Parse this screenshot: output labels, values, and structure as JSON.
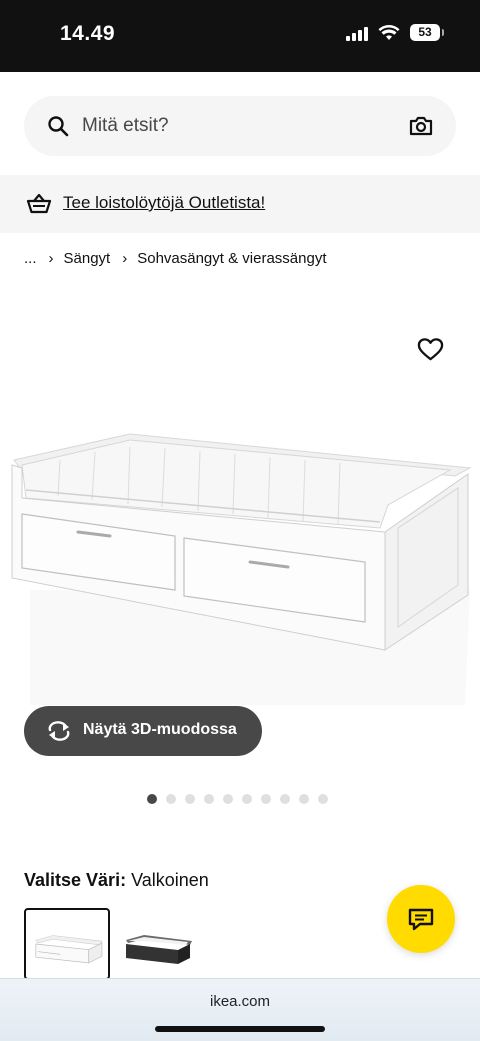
{
  "status_bar": {
    "time": "14.49",
    "battery": "53"
  },
  "search": {
    "placeholder": "Mitä etsit?",
    "icon": "search-icon",
    "camera_icon": "camera-icon"
  },
  "promo": {
    "icon": "basket-icon",
    "link_text": "Tee loistolöytöjä Outletista!"
  },
  "breadcrumb": {
    "items": [
      "...",
      "Sängyt",
      "Sohvasängyt & vierassängyt"
    ],
    "separator": "›"
  },
  "product": {
    "favorite_icon": "heart-icon",
    "view_3d_label": "Näytä 3D-muodossa",
    "image_count": 10,
    "active_image_index": 0
  },
  "color_selector": {
    "label": "Valitse Väri:",
    "selected_value": "Valkoinen",
    "options": [
      "white",
      "black"
    ]
  },
  "chat": {
    "icon": "chat-bubble-icon",
    "color": "#ffdb00"
  },
  "browser": {
    "url": "ikea.com"
  },
  "colors": {
    "status_bar_bg": "#111111",
    "button_dark": "#484848",
    "accent_yellow": "#ffdb00",
    "light_gray_bg": "#f5f5f5"
  }
}
